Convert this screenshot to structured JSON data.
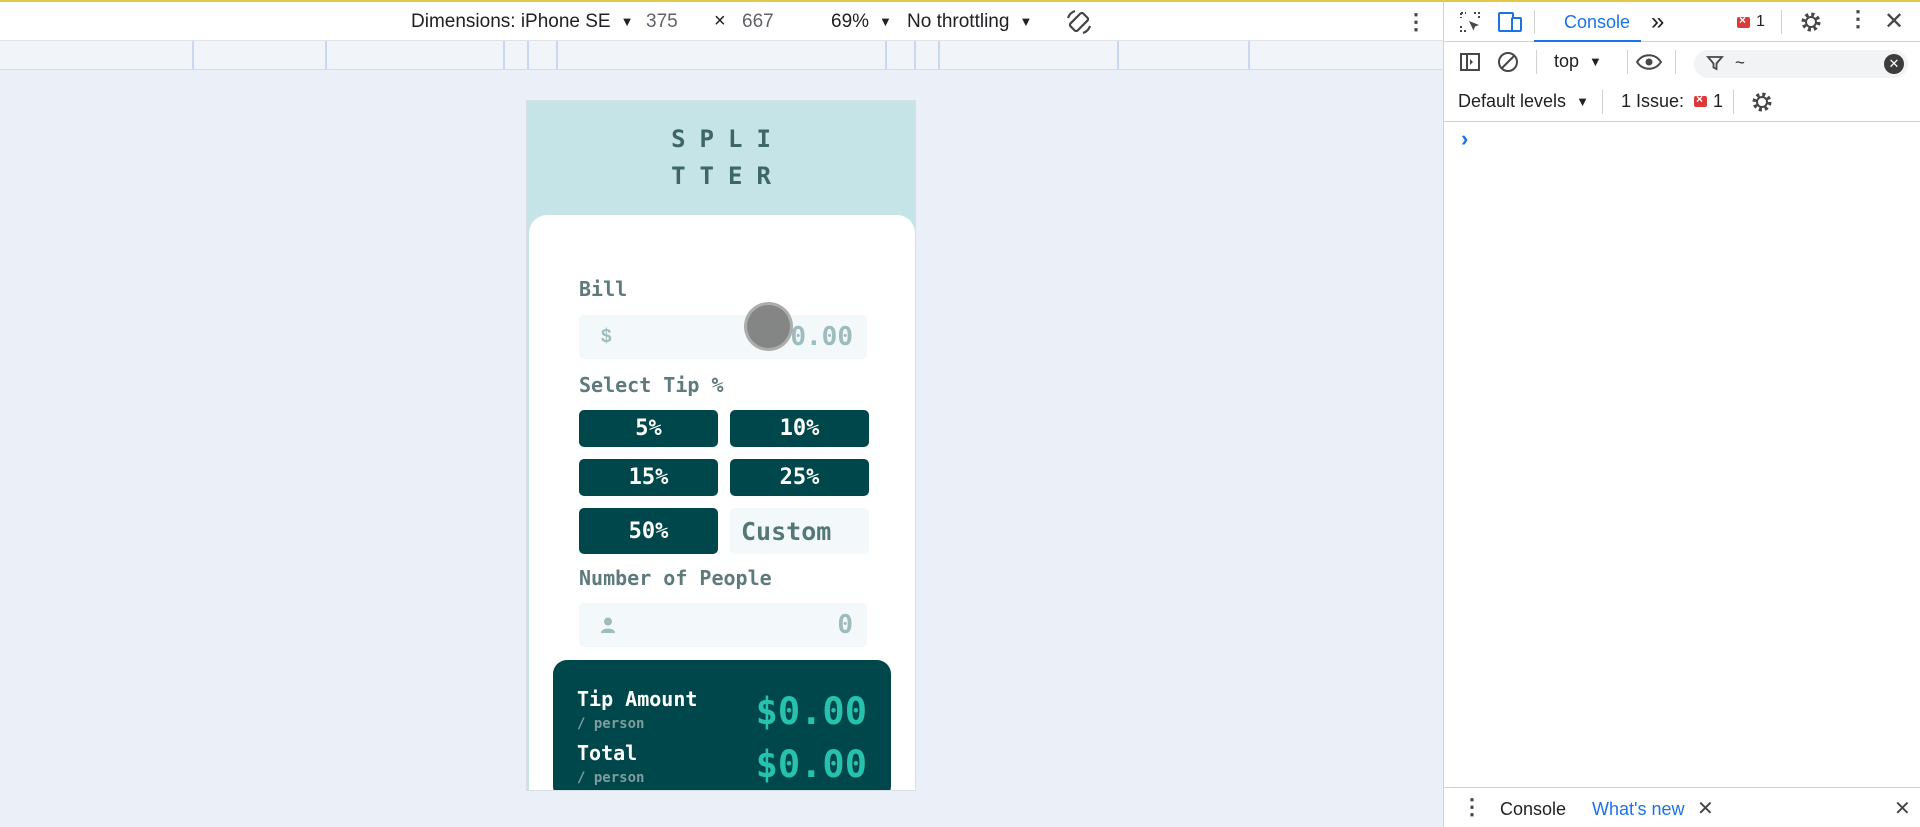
{
  "device_toolbar": {
    "dimensions_label": "Dimensions: iPhone SE",
    "width": "375",
    "times": "×",
    "height": "667",
    "zoom": "69%",
    "throttling": "No throttling"
  },
  "app": {
    "logo_line1": "SPLI",
    "logo_line2": "TTER",
    "bill_label": "Bill",
    "bill_prefix": "$",
    "bill_value": "0.00",
    "tip_label": "Select Tip %",
    "tips": [
      "5%",
      "10%",
      "15%",
      "25%",
      "50%"
    ],
    "custom_placeholder": "Custom",
    "people_label": "Number of People",
    "people_value": "0",
    "tip_amount_label": "Tip Amount",
    "tip_amount_sub": "/ person",
    "tip_amount_value": "$0.00",
    "total_label": "Total",
    "total_sub": "/ person",
    "total_value": "$0.00"
  },
  "devtools": {
    "tab_console": "Console",
    "error_count": "1",
    "context": "top",
    "filter_value": "~",
    "levels": "Default levels",
    "issues_label": "1 Issue:",
    "issues_count": "1",
    "prompt": "›",
    "drawer_tabs": [
      "Console",
      "What's new"
    ]
  },
  "colors": {
    "app_bg": "#c5e4e7",
    "dark_teal": "#00474b",
    "accent": "#26c2ae",
    "devtools_accent": "#1a73e8",
    "error": "#dc3939"
  }
}
